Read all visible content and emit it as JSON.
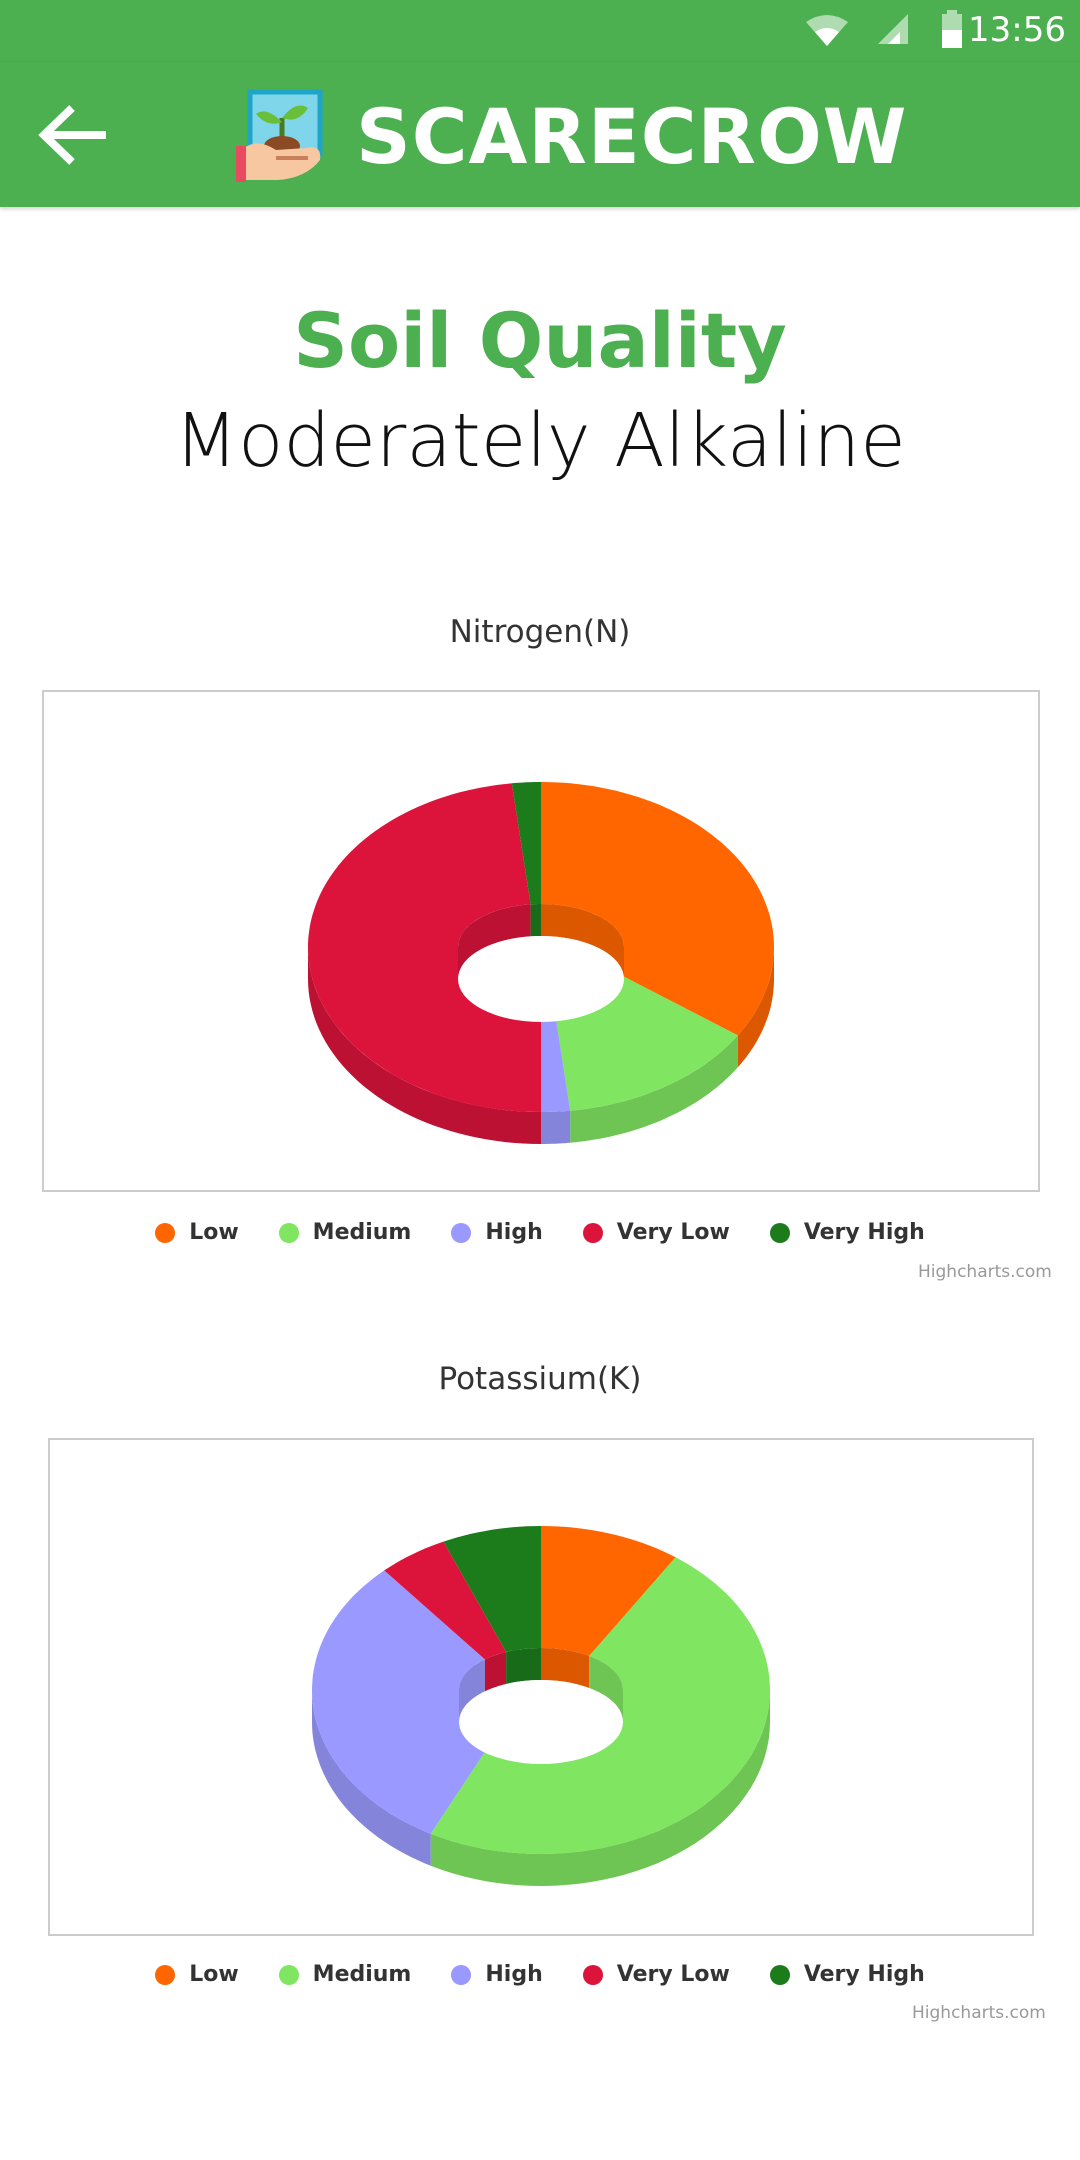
{
  "status_bar": {
    "time": "13:56",
    "icons": [
      "wifi-icon",
      "signal-icon",
      "battery-icon"
    ]
  },
  "app_bar": {
    "title": "SCARECROW",
    "back_icon": "arrow-left-icon",
    "logo_icon": "plant-in-hand-icon",
    "color": "#4caf50"
  },
  "header": {
    "title": "Soil Quality",
    "subtitle": "Moderately Alkaline"
  },
  "colors": {
    "Low": "#ff6600",
    "Medium": "#80e561",
    "High": "#9999ff",
    "Very Low": "#dc143c",
    "Very High": "#1c7c1c"
  },
  "chart_data": [
    {
      "type": "pie",
      "variant": "3d-donut",
      "title": "Nitrogen(N)",
      "slices": [
        {
          "name": "Low",
          "value": 34
        },
        {
          "name": "Medium",
          "value": 14
        },
        {
          "name": "High",
          "value": 2
        },
        {
          "name": "Very Low",
          "value": 48
        },
        {
          "name": "Very High",
          "value": 2
        }
      ],
      "legend": [
        "Low",
        "Medium",
        "High",
        "Very Low",
        "Very High"
      ],
      "credits": "Highcharts.com"
    },
    {
      "type": "pie",
      "variant": "3d-donut",
      "title": "Potassium(K)",
      "slices": [
        {
          "name": "Low",
          "value": 10
        },
        {
          "name": "Medium",
          "value": 48
        },
        {
          "name": "High",
          "value": 30
        },
        {
          "name": "Very Low",
          "value": 5
        },
        {
          "name": "Very High",
          "value": 7
        }
      ],
      "legend": [
        "Low",
        "Medium",
        "High",
        "Very Low",
        "Very High"
      ],
      "credits": "Highcharts.com"
    }
  ]
}
